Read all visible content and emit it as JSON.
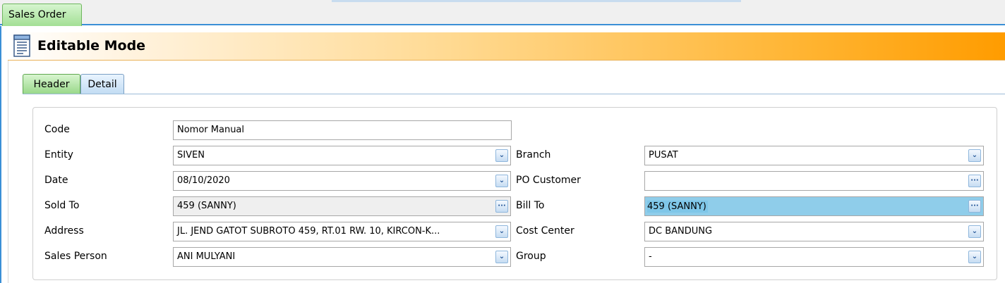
{
  "window": {
    "tab_label": "Sales Order",
    "mode_title": "Editable Mode"
  },
  "tabs": [
    {
      "label": "Header",
      "active": true
    },
    {
      "label": "Detail",
      "active": false
    }
  ],
  "form": {
    "code": {
      "label": "Code",
      "value": "Nomor Manual"
    },
    "entity": {
      "label": "Entity",
      "value": "SIVEN"
    },
    "date": {
      "label": "Date",
      "value": "08/10/2020"
    },
    "sold_to": {
      "label": "Sold To",
      "value": "459 (SANNY)"
    },
    "address": {
      "label": "Address",
      "value": "JL. JEND GATOT SUBROTO 459, RT.01 RW. 10, KIRCON-K..."
    },
    "sales_person": {
      "label": "Sales Person",
      "value": "ANI MULYANI"
    },
    "branch": {
      "label": "Branch",
      "value": "PUSAT"
    },
    "po_customer": {
      "label": "PO Customer",
      "value": ""
    },
    "bill_to": {
      "label": "Bill To",
      "value": "459 (SANNY)"
    },
    "cost_center": {
      "label": "Cost Center",
      "value": "DC BANDUNG"
    },
    "group": {
      "label": "Group",
      "value": "-"
    }
  },
  "icons": {
    "dropdown": "chevron-down-icon",
    "lookup": "ellipsis-icon",
    "document": "document-icon"
  },
  "colors": {
    "active_tab": "#a3df95",
    "title_gradient_end": "#ff9c00",
    "selection": "#8fcdea",
    "frame_blue": "#3a8fd6"
  }
}
